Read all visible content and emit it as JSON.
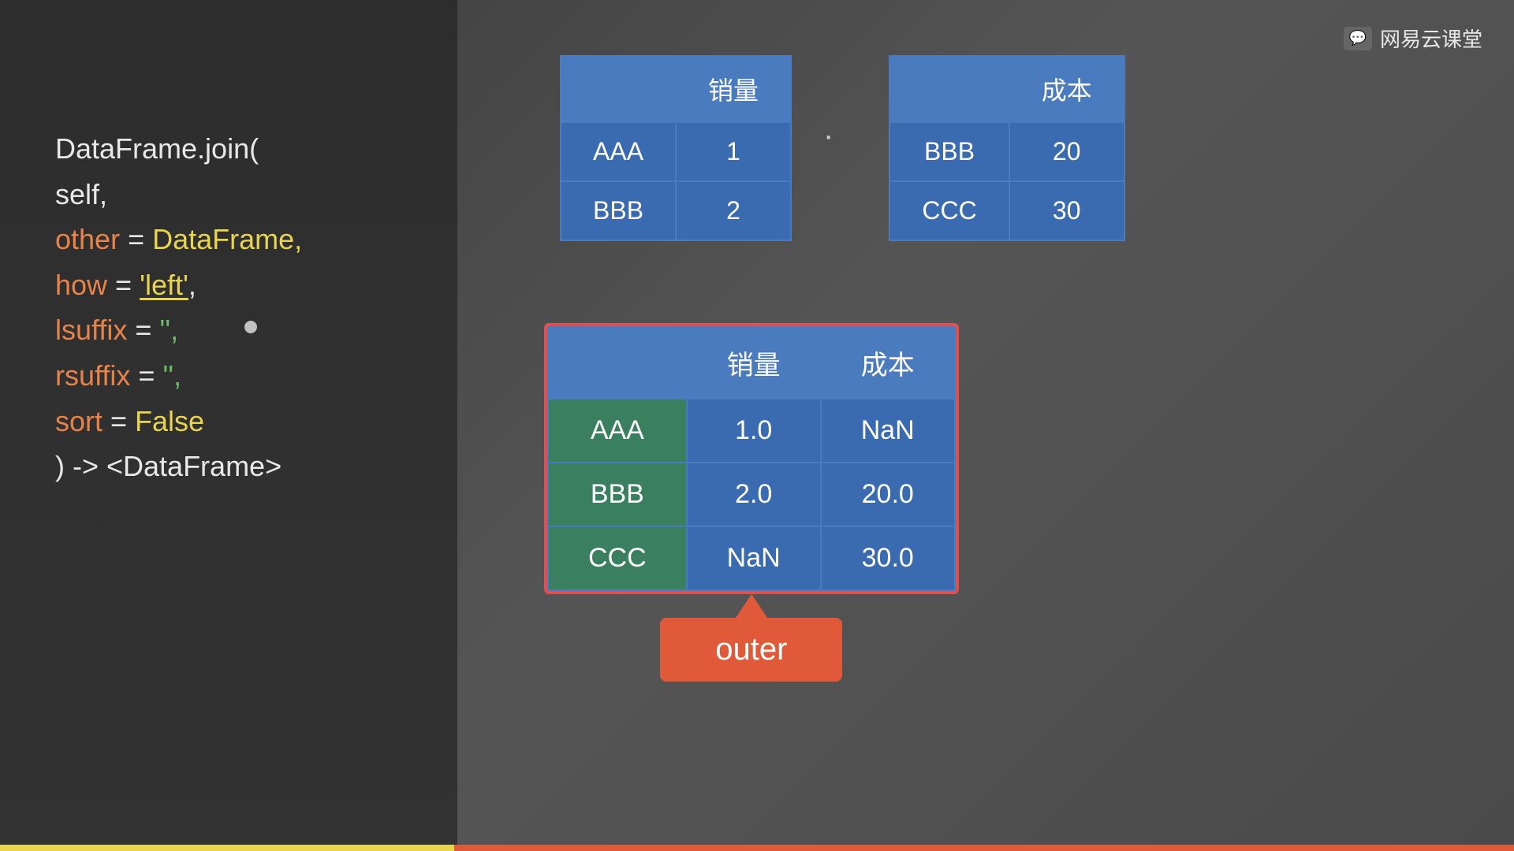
{
  "logo": {
    "text": "网易云课堂",
    "icon": "💬"
  },
  "code": {
    "line1": "DataFrame.join(",
    "line2_indent": "    self,",
    "line3_prefix": "    ",
    "line3_other": "other",
    "line3_eq": " = ",
    "line3_val": "DataFrame,",
    "line4_prefix": "    ",
    "line4_how": "how",
    "line4_eq": " = ",
    "line4_val": "'left'",
    "line4_comma": ",",
    "line5_prefix": "    ",
    "line5_lsuffix": "lsuffix",
    "line5_eq": " = ",
    "line5_val": "'',",
    "line6_prefix": "    ",
    "line6_rsuffix": "rsuffix",
    "line6_eq": " = ",
    "line6_val": "'',",
    "line7_prefix": "    ",
    "line7_sort": "sort",
    "line7_eq": " = ",
    "line7_val": "False",
    "line8": ") -> <DataFrame>"
  },
  "left_table": {
    "header": [
      "",
      "销量"
    ],
    "rows": [
      [
        "AAA",
        "1"
      ],
      [
        "BBB",
        "2"
      ]
    ]
  },
  "right_table": {
    "header": [
      "",
      "成本"
    ],
    "rows": [
      [
        "BBB",
        "20"
      ],
      [
        "CCC",
        "30"
      ]
    ]
  },
  "result_table": {
    "header": [
      "",
      "销量",
      "成本"
    ],
    "rows": [
      [
        "AAA",
        "1.0",
        "NaN"
      ],
      [
        "BBB",
        "2.0",
        "20.0"
      ],
      [
        "CCC",
        "NaN",
        "30.0"
      ]
    ]
  },
  "outer_badge": {
    "label": "outer"
  }
}
